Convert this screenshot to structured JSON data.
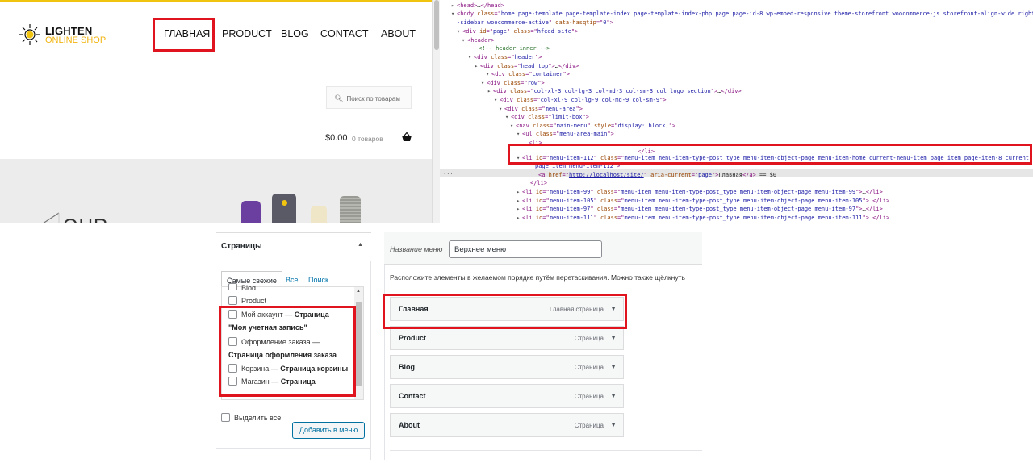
{
  "site": {
    "logo_line1": "LIGHTEN",
    "logo_line2": "ONLINE SHOP",
    "nav": [
      "ГЛАВНАЯ",
      "PRODUCT",
      "BLOG",
      "CONTACT",
      "ABOUT"
    ],
    "search_placeholder": "Поиск по товарам",
    "cart_price": "$0.00",
    "cart_count": "0 товаров",
    "hero_text": "OUR"
  },
  "devtools": {
    "lines": [
      {
        "indent": 0,
        "tri": "▸",
        "parts": [
          [
            "tg",
            "<head>"
          ],
          [
            "tx",
            "…"
          ],
          [
            "tg",
            "</head>"
          ]
        ]
      },
      {
        "indent": 0,
        "tri": "▾",
        "parts": [
          [
            "tg",
            "<body "
          ],
          [
            "an",
            "class"
          ],
          [
            "tg",
            "=\""
          ],
          [
            "av",
            "home page-template page-template-index page-template-index-php page page-id-8 wp-embed-responsive theme-storefront woocommerce-js storefront-align-wide right"
          ],
          [
            "tg",
            ""
          ]
        ]
      },
      {
        "indent": 0,
        "tri": "",
        "parts": [
          [
            "av",
            "-sidebar woocommerce-active"
          ],
          [
            "tg",
            "\" "
          ],
          [
            "an",
            "data-hasqtip"
          ],
          [
            "tg",
            "=\""
          ],
          [
            "av",
            "0"
          ],
          [
            "tg",
            "\">"
          ]
        ]
      },
      {
        "indent": 1,
        "tri": "▾",
        "parts": [
          [
            "tg",
            "<div "
          ],
          [
            "an",
            "id"
          ],
          [
            "tg",
            "=\""
          ],
          [
            "av",
            "page"
          ],
          [
            "tg",
            "\" "
          ],
          [
            "an",
            "class"
          ],
          [
            "tg",
            "=\""
          ],
          [
            "av",
            "hfeed site"
          ],
          [
            "tg",
            "\">"
          ]
        ]
      },
      {
        "indent": 2,
        "tri": "▾",
        "parts": [
          [
            "tg",
            "<header>"
          ]
        ]
      },
      {
        "indent": 3,
        "tri": "",
        "parts": [
          [
            "cm",
            "<!-- header inner -->"
          ]
        ]
      },
      {
        "indent": 3,
        "tri": "▾",
        "parts": [
          [
            "tg",
            "<div "
          ],
          [
            "an",
            "class"
          ],
          [
            "tg",
            "=\""
          ],
          [
            "av",
            "header"
          ],
          [
            "tg",
            "\">"
          ]
        ]
      },
      {
        "indent": 4,
        "tri": "▸",
        "parts": [
          [
            "tg",
            "<div "
          ],
          [
            "an",
            "class"
          ],
          [
            "tg",
            "=\""
          ],
          [
            "av",
            "head_top"
          ],
          [
            "tg",
            "\">"
          ],
          [
            "tx",
            "…"
          ],
          [
            "tg",
            "</div>"
          ]
        ]
      },
      {
        "indent": 4,
        "tri": "▾",
        "parts": [
          [
            "tg",
            "<div "
          ],
          [
            "an",
            "class"
          ],
          [
            "tg",
            "=\""
          ],
          [
            "av",
            "container"
          ],
          [
            "tg",
            "\">"
          ]
        ]
      },
      {
        "indent": 5,
        "tri": "▾",
        "parts": [
          [
            "tg",
            "<div "
          ],
          [
            "an",
            "class"
          ],
          [
            "tg",
            "=\""
          ],
          [
            "av",
            "row"
          ],
          [
            "tg",
            "\">"
          ]
        ]
      },
      {
        "indent": 6,
        "tri": "▸",
        "parts": [
          [
            "tg",
            "<div "
          ],
          [
            "an",
            "class"
          ],
          [
            "tg",
            "=\""
          ],
          [
            "av",
            "col-xl-3 col-lg-3 col-md-3 col-sm-3 col logo_section"
          ],
          [
            "tg",
            "\">"
          ],
          [
            "tx",
            "…"
          ],
          [
            "tg",
            "</div>"
          ]
        ]
      },
      {
        "indent": 6,
        "tri": "▾",
        "parts": [
          [
            "tg",
            "<div "
          ],
          [
            "an",
            "class"
          ],
          [
            "tg",
            "=\""
          ],
          [
            "av",
            "col-xl-9 col-lg-9 col-md-9 col-sm-9"
          ],
          [
            "tg",
            "\">"
          ]
        ]
      },
      {
        "indent": 7,
        "tri": "▾",
        "parts": [
          [
            "tg",
            "<div "
          ],
          [
            "an",
            "class"
          ],
          [
            "tg",
            "=\""
          ],
          [
            "av",
            "menu-area"
          ],
          [
            "tg",
            "\">"
          ]
        ]
      },
      {
        "indent": 8,
        "tri": "▾",
        "parts": [
          [
            "tg",
            "<div "
          ],
          [
            "an",
            "class"
          ],
          [
            "tg",
            "=\""
          ],
          [
            "av",
            "limit-box"
          ],
          [
            "tg",
            "\">"
          ]
        ]
      },
      {
        "indent": 9,
        "tri": "▾",
        "parts": [
          [
            "tg",
            "<nav "
          ],
          [
            "an",
            "class"
          ],
          [
            "tg",
            "=\""
          ],
          [
            "av",
            "main-menu"
          ],
          [
            "tg",
            "\" "
          ],
          [
            "an",
            "style"
          ],
          [
            "tg",
            "=\""
          ],
          [
            "av",
            "display: block;"
          ],
          [
            "tg",
            "\">"
          ]
        ]
      },
      {
        "indent": 10,
        "tri": "▾",
        "parts": [
          [
            "tg",
            "<ul "
          ],
          [
            "an",
            "class"
          ],
          [
            "tg",
            "=\""
          ],
          [
            "av",
            "menu-area-main"
          ],
          [
            "tg",
            "\">"
          ]
        ]
      },
      {
        "indent": 11,
        "tri": "",
        "parts": [
          [
            "tg",
            "<li>"
          ]
        ]
      },
      {
        "indent": 20,
        "tri": "",
        "parts": [
          [
            "tg",
            "</li>"
          ]
        ]
      },
      {
        "indent": 11,
        "tri": "▾",
        "parts": [
          [
            "tg",
            "<li "
          ],
          [
            "an",
            "id"
          ],
          [
            "tg",
            "=\""
          ],
          [
            "av",
            "menu-item-112"
          ],
          [
            "tg",
            "\" "
          ],
          [
            "an",
            "class"
          ],
          [
            "tg",
            "=\""
          ],
          [
            "av",
            "menu-item menu-item-type-post_type menu-item-object-page menu-item-home current-menu-item page_item page-item-8 current_"
          ]
        ]
      },
      {
        "indent": 11,
        "tri": "",
        "parts": [
          [
            "av",
            "page_item menu-item-112"
          ],
          [
            "tg",
            "\">"
          ]
        ]
      },
      {
        "indent": 13,
        "tri": "",
        "parts": [
          [
            "tg",
            "<a "
          ],
          [
            "an",
            "href"
          ],
          [
            "tg",
            "=\""
          ],
          [
            "lk",
            "http://localhost/site/"
          ],
          [
            "tg",
            "\" "
          ],
          [
            "an",
            "aria-current"
          ],
          [
            "tg",
            "=\""
          ],
          [
            "av",
            "page"
          ],
          [
            "tg",
            "\">"
          ],
          [
            "tx",
            "Главная"
          ],
          [
            "tg",
            "</a>"
          ],
          [
            "tx",
            " == $0"
          ]
        ]
      },
      {
        "indent": 12,
        "tri": "",
        "parts": [
          [
            "tg",
            "</li>"
          ]
        ]
      },
      {
        "indent": 11,
        "tri": "▸",
        "parts": [
          [
            "tg",
            "<li "
          ],
          [
            "an",
            "id"
          ],
          [
            "tg",
            "=\""
          ],
          [
            "av",
            "menu-item-99"
          ],
          [
            "tg",
            "\" "
          ],
          [
            "an",
            "class"
          ],
          [
            "tg",
            "=\""
          ],
          [
            "av",
            "menu-item menu-item-type-post_type menu-item-object-page menu-item-99"
          ],
          [
            "tg",
            "\">"
          ],
          [
            "tx",
            "…"
          ],
          [
            "tg",
            "</li>"
          ]
        ]
      },
      {
        "indent": 11,
        "tri": "▸",
        "parts": [
          [
            "tg",
            "<li "
          ],
          [
            "an",
            "id"
          ],
          [
            "tg",
            "=\""
          ],
          [
            "av",
            "menu-item-105"
          ],
          [
            "tg",
            "\" "
          ],
          [
            "an",
            "class"
          ],
          [
            "tg",
            "=\""
          ],
          [
            "av",
            "menu-item menu-item-type-post_type menu-item-object-page menu-item-105"
          ],
          [
            "tg",
            "\">"
          ],
          [
            "tx",
            "…"
          ],
          [
            "tg",
            "</li>"
          ]
        ]
      },
      {
        "indent": 11,
        "tri": "▸",
        "parts": [
          [
            "tg",
            "<li "
          ],
          [
            "an",
            "id"
          ],
          [
            "tg",
            "=\""
          ],
          [
            "av",
            "menu-item-97"
          ],
          [
            "tg",
            "\" "
          ],
          [
            "an",
            "class"
          ],
          [
            "tg",
            "=\""
          ],
          [
            "av",
            "menu-item menu-item-type-post_type menu-item-object-page menu-item-97"
          ],
          [
            "tg",
            "\">"
          ],
          [
            "tx",
            "…"
          ],
          [
            "tg",
            "</li>"
          ]
        ]
      },
      {
        "indent": 11,
        "tri": "▸",
        "parts": [
          [
            "tg",
            "<li "
          ],
          [
            "an",
            "id"
          ],
          [
            "tg",
            "=\""
          ],
          [
            "av",
            "menu-item-111"
          ],
          [
            "tg",
            "\" "
          ],
          [
            "an",
            "class"
          ],
          [
            "tg",
            "=\""
          ],
          [
            "av",
            "menu-item menu-item-type-post_type menu-item-object-page menu-item-111"
          ],
          [
            "tg",
            "\">"
          ],
          [
            "tx",
            "…"
          ],
          [
            "tg",
            "</li>"
          ]
        ]
      },
      {
        "indent": 11,
        "tri": "",
        "parts": [
          [
            "tg",
            "</ul>"
          ]
        ]
      }
    ],
    "gutter_dots": "..."
  },
  "pages_panel": {
    "title": "Страницы",
    "tabs": [
      "Самые свежие",
      "Все",
      "Поиск"
    ],
    "items": [
      {
        "label": "Blog",
        "suffix": ""
      },
      {
        "label": "Product",
        "suffix": ""
      },
      {
        "label": "Мой аккаунт — ",
        "suffix": "Страница"
      },
      {
        "label": "",
        "suffix": "\"Моя учетная запись\""
      },
      {
        "label": "Оформление заказа —",
        "suffix": ""
      },
      {
        "label": "",
        "suffix": "Страница оформления заказа"
      },
      {
        "label": "Корзина — ",
        "suffix": "Страница корзины"
      },
      {
        "label": "Магазин — ",
        "suffix": "Страница"
      }
    ],
    "select_all": "Выделить все",
    "add_button": "Добавить в меню"
  },
  "menu_editor": {
    "name_label": "Название меню",
    "name_value": "Верхнее меню",
    "instruction": "Расположите элементы в желаемом порядке путём перетаскивания. Можно также щёлкнуть",
    "items": [
      {
        "title": "Главная",
        "type": "Главная страница"
      },
      {
        "title": "Product",
        "type": "Страница"
      },
      {
        "title": "Blog",
        "type": "Страница"
      },
      {
        "title": "Contact",
        "type": "Страница"
      },
      {
        "title": "About",
        "type": "Страница"
      }
    ]
  },
  "colors": {
    "highlight": "#e0141e",
    "brand": "#f1b40f",
    "wp_blue": "#0073aa"
  }
}
